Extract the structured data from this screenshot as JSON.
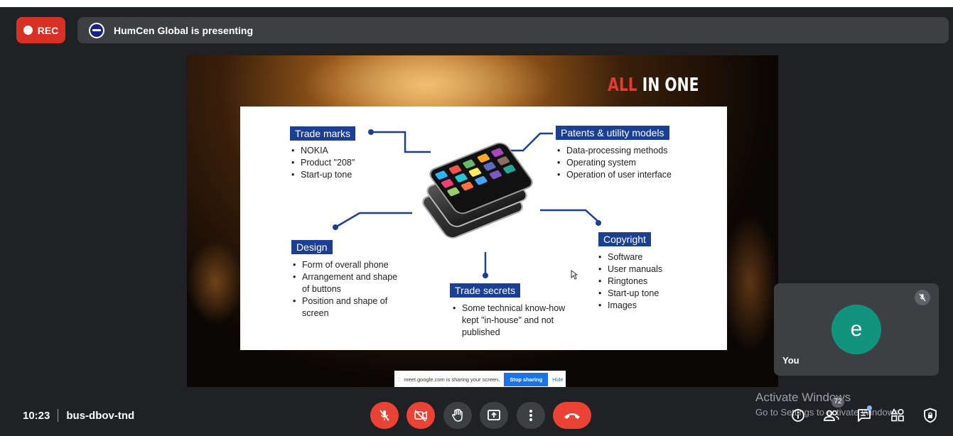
{
  "recording": {
    "label": "REC"
  },
  "presenter": {
    "text": "HumCen Global is presenting"
  },
  "slide": {
    "title_accent": "ALL",
    "title_rest": " IN ONE",
    "sections": {
      "trade_marks": {
        "label": "Trade marks",
        "items": [
          "NOKIA",
          "Product \"208\"",
          "Start-up tone"
        ]
      },
      "patents": {
        "label": "Patents & utility models",
        "items": [
          "Data-processing methods",
          "Operating system",
          "Operation of user interface"
        ]
      },
      "design": {
        "label": "Design",
        "items": [
          "Form of overall phone",
          "Arrangement and shape of buttons",
          "Position and shape of screen"
        ]
      },
      "trade_secrets": {
        "label": "Trade secrets",
        "items": [
          "Some technical know-how kept \"in-house\" and not published"
        ]
      },
      "copyright": {
        "label": "Copyright",
        "items": [
          "Software",
          "User manuals",
          "Ringtones",
          "Start-up tone",
          "Images"
        ]
      }
    }
  },
  "share_bar": {
    "message": "meet.google.com is sharing your screen.",
    "stop_label": "Stop sharing",
    "hide_label": "Hide"
  },
  "self_view": {
    "initial": "e",
    "name": "You"
  },
  "meeting": {
    "time": "10:23",
    "code": "bus-dbov-tnd"
  },
  "watermark": {
    "line1": "Activate Windows",
    "line2": "Go to Settings to activate Windows."
  },
  "participants": {
    "count": "72"
  },
  "icons": {
    "mic": "mic-off-icon",
    "camera": "camera-off-icon",
    "hand": "raise-hand-icon",
    "present": "present-screen-icon",
    "more": "more-vert-icon",
    "leave": "call-end-icon",
    "info": "info-icon",
    "people": "people-icon",
    "chat": "chat-icon",
    "activities": "activities-icon",
    "host": "host-controls-icon"
  },
  "colors": {
    "accent_red": "#ea4335",
    "slide_blue": "#1b3f93",
    "avatar": "#12937d"
  }
}
